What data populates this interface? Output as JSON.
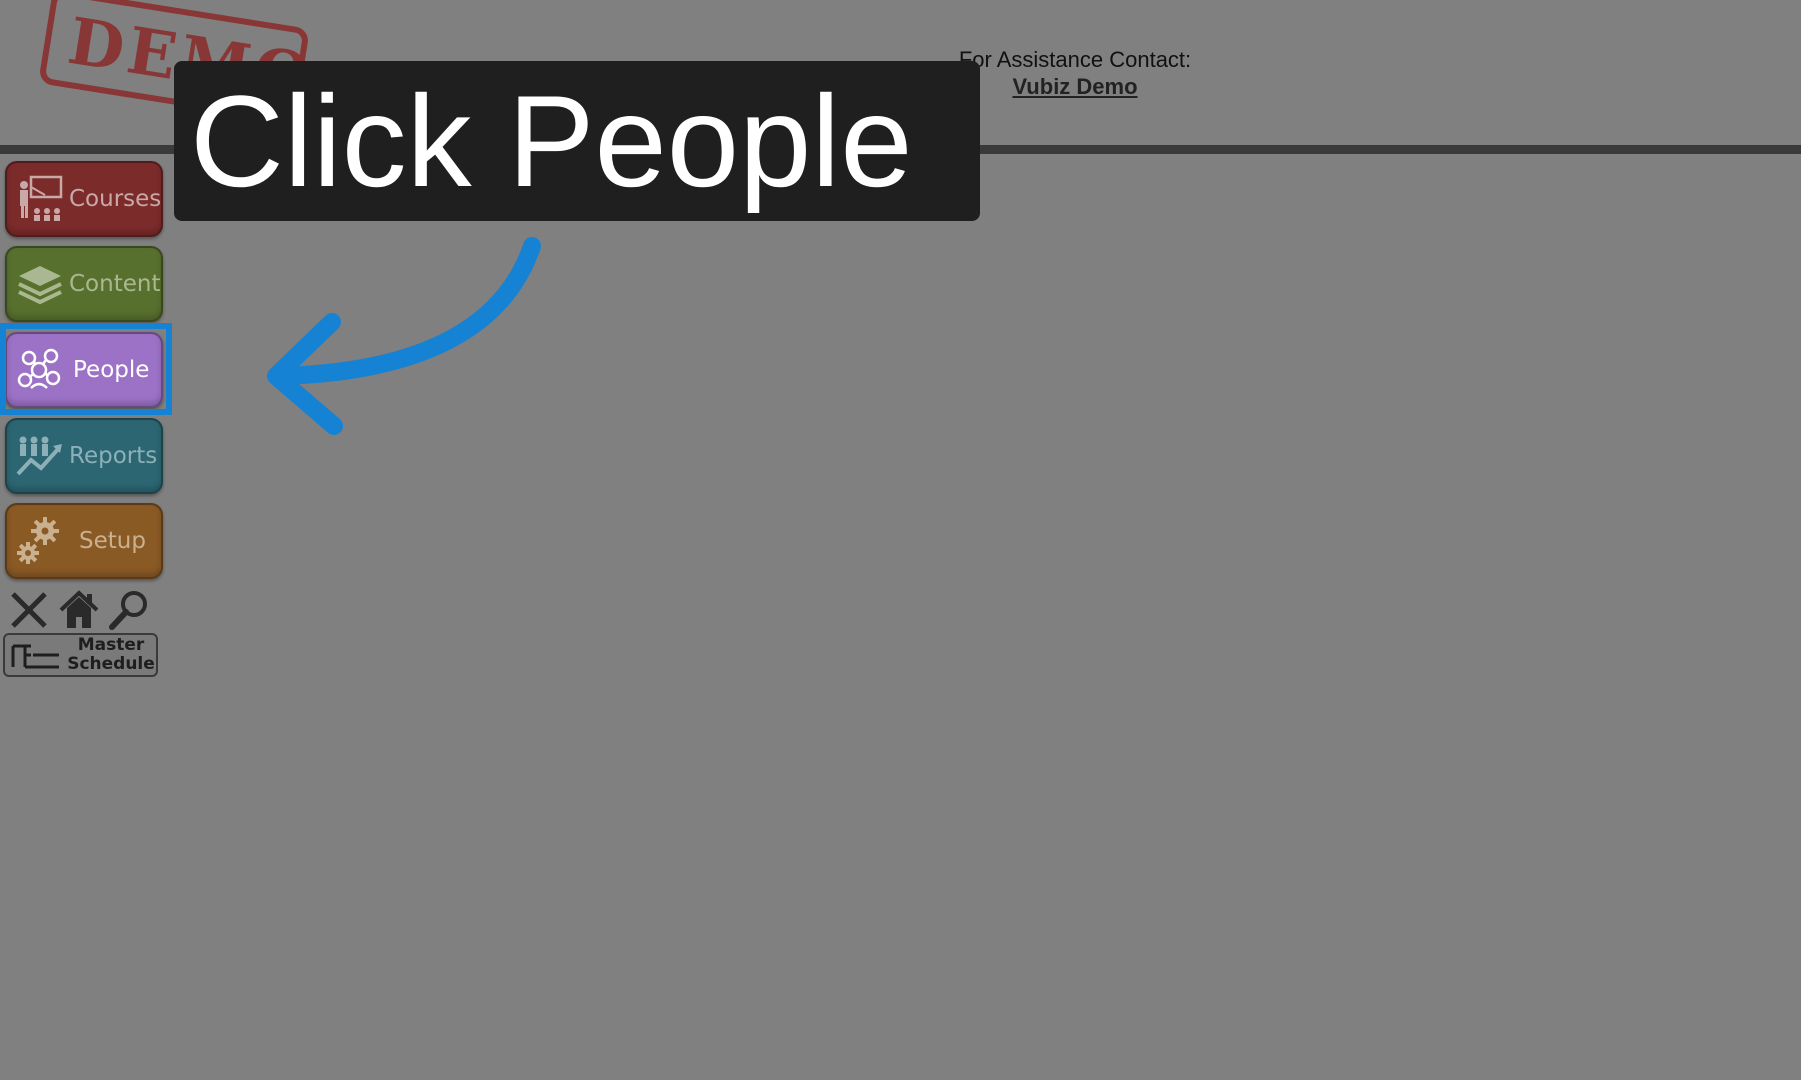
{
  "header": {
    "assist_label": "For Assistance Contact:",
    "assist_link": "Vubiz Demo",
    "stamp_text": "DEMO"
  },
  "callout": {
    "text": "Click People",
    "accent_color": "#1582d4"
  },
  "sidebar": {
    "items": [
      {
        "label": "Courses",
        "icon": "presentation-icon",
        "color": "#7c2b2b"
      },
      {
        "label": "Content",
        "icon": "stack-icon",
        "color": "#58702e"
      },
      {
        "label": "People",
        "icon": "network-people-icon",
        "color": "#9c72c6",
        "highlighted": true
      },
      {
        "label": "Reports",
        "icon": "chart-people-icon",
        "color": "#2c6672"
      },
      {
        "label": "Setup",
        "icon": "gears-icon",
        "color": "#8a5a25"
      }
    ],
    "tools": [
      {
        "icon": "close-icon"
      },
      {
        "icon": "home-icon"
      },
      {
        "icon": "search-icon"
      }
    ],
    "master_schedule": {
      "line1": "Master",
      "line2": "Schedule",
      "icon": "schedule-icon"
    }
  }
}
